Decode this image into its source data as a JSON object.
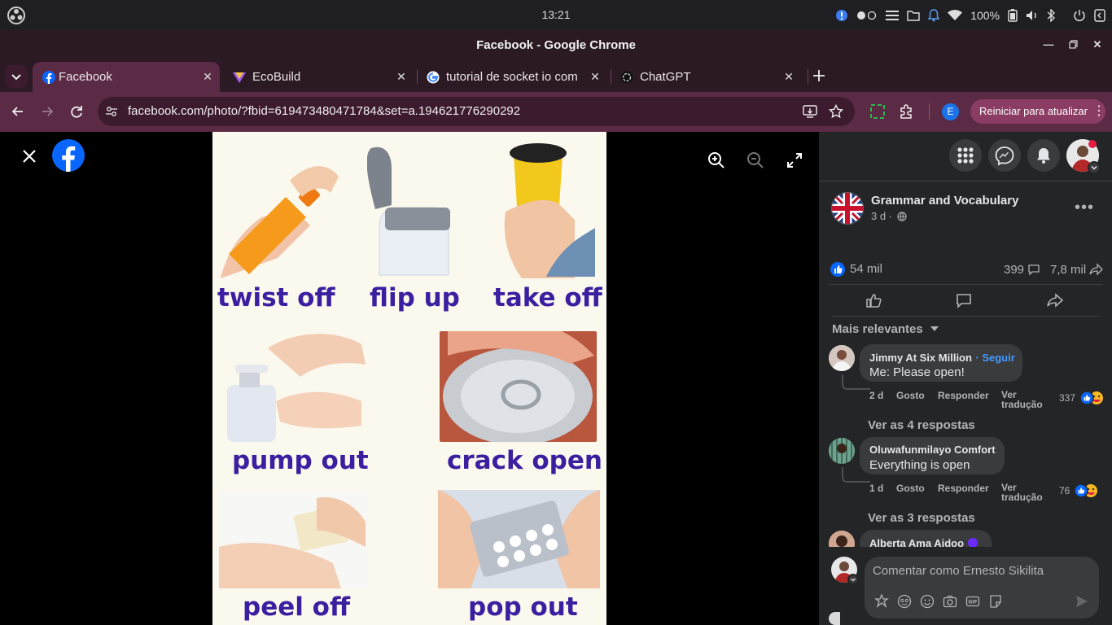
{
  "os": {
    "clock": "13:21",
    "battery": "100%"
  },
  "window": {
    "title": "Facebook - Google Chrome"
  },
  "tabs": [
    {
      "label": "Facebook",
      "active": true
    },
    {
      "label": "EcoBuild"
    },
    {
      "label": "tutorial de socket io com"
    },
    {
      "label": "ChatGPT"
    }
  ],
  "toolbar": {
    "url": "facebook.com/photo/?fbid=619473480471784&set=a.194621776290292",
    "profile_initial": "E",
    "restart_label": "Reiniciar para atualizar"
  },
  "photo": {
    "captions": [
      "twist off",
      "flip up",
      "take off",
      "pump out",
      "crack open",
      "peel off",
      "pop out"
    ]
  },
  "post": {
    "page_name": "Grammar and Vocabulary",
    "time": "3 d ·",
    "reactions_count": "54 mil",
    "comments_count": "399",
    "shares_count": "7,8 mil",
    "sort_label": "Mais relevantes"
  },
  "comments": [
    {
      "author": "Jimmy At Six Million",
      "follow": "· Seguir",
      "text": "Me: Please open!",
      "time": "2 d",
      "like": "Gosto",
      "reply": "Responder",
      "translate": "Ver tradução",
      "reactions": "337",
      "view_replies": "Ver as 4 respostas"
    },
    {
      "author": "Oluwafunmilayo Comfort",
      "text": "Everything is open",
      "time": "1 d",
      "like": "Gosto",
      "reply": "Responder",
      "translate": "Ver tradução",
      "reactions": "76",
      "view_replies": "Ver as 3 respostas"
    },
    {
      "author": "Alberta Ama Aidoo"
    }
  ],
  "composer": {
    "placeholder": "Comentar como Ernesto Sikilita"
  },
  "colors": {
    "accent": "#5b2a45",
    "fb_blue": "#0866ff",
    "link": "#4599ff"
  }
}
